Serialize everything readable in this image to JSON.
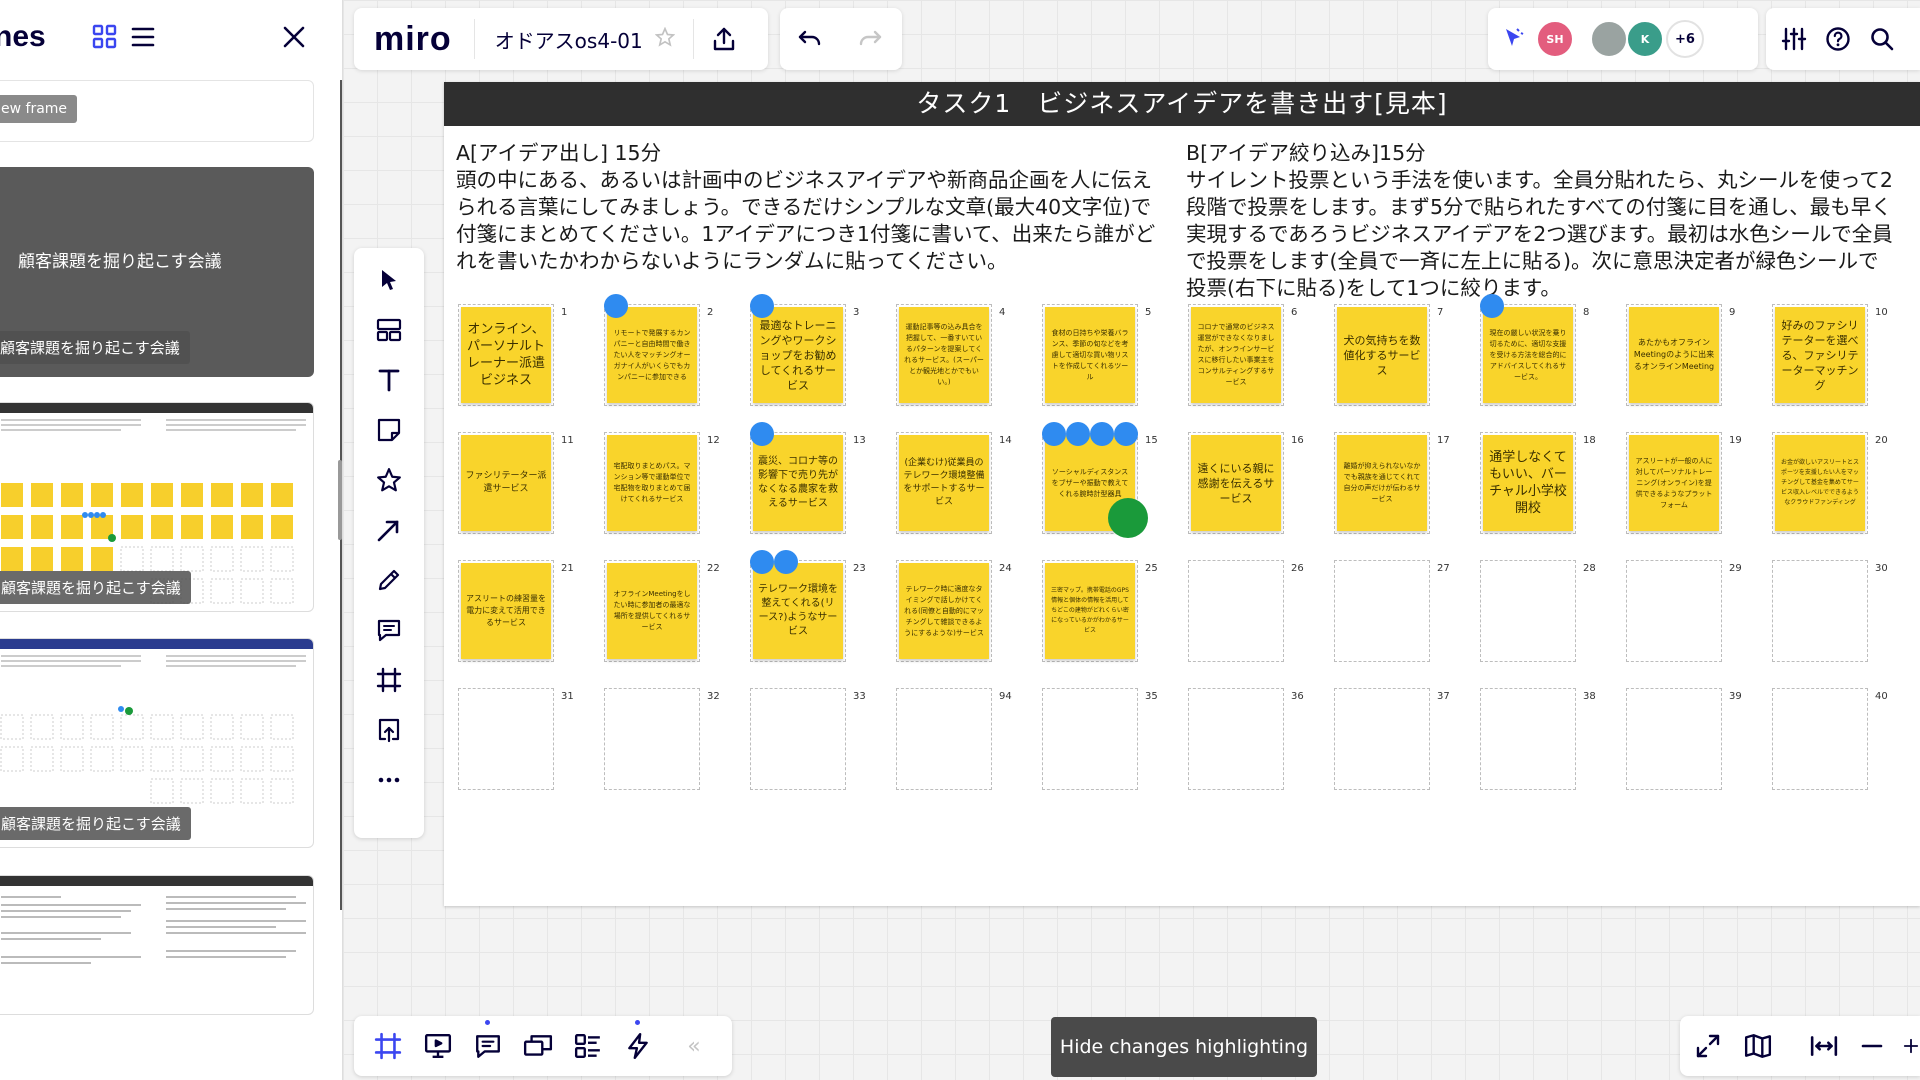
{
  "frames_panel": {
    "title": "nes",
    "new_frame_label": "ew frame",
    "thumb1_title": "顧客課題を掘り起こす会議",
    "thumb1_tag": "顧客課題を掘り起こす会議",
    "thumb2_tag": "顧客課題を掘り起こす会議",
    "thumb3_tag": "顧客課題を掘り起こす会議"
  },
  "topbar": {
    "logo": "miro",
    "board_name": "オドアスos4-01",
    "avatars": [
      {
        "initials": "SH",
        "color": "#e35d7e"
      },
      {
        "initials": "",
        "color": "#9aa3a1"
      },
      {
        "initials": "K",
        "color": "#3a9d8a"
      }
    ],
    "more_count": "+6"
  },
  "frame": {
    "title": "タスク1　ビジネスアイデアを書き出す[見本]",
    "text_a": "A[アイデア出し] 15分\n頭の中にある、あるいは計画中のビジネスアイデアや新商品企画を人に伝えられる言葉にしてみましょう。できるだけシンプルな文章(最大40文字位)で付箋にまとめてください。1アイデアにつき1付箋に書いて、出来たら誰がどれを書いたかわからないようにランダムに貼ってください。",
    "text_b": "B[アイデア絞り込み]15分\nサイレント投票という手法を使います。全員分貼れたら、丸シールを使って2段階で投票をします。まず5分で貼られたすべての付箋に目を通し、最も早く実現するであろうビジネスアイデアを2つ選びます。最初は水色シールで全員で投票をします(全員で一斉に左上に貼る)。次に意思決定者が緑色シールで投票(右下に貼る)をして1つに絞ります。"
  },
  "cells": [
    {
      "num": "1",
      "text": "オンライン、パーソナルトレーナー派遣ビジネス",
      "size": 13
    },
    {
      "num": "2",
      "text": "リモートで発展するカンパニーと自由時間で働きたい人をマッチングオーガナイ人がいくらでもカンパニーに参加できる",
      "size": 7
    },
    {
      "num": "3",
      "text": "最適なトレーニングやワークショップをお勧めしてくれるサービス",
      "size": 11
    },
    {
      "num": "4",
      "text": "運動記事等の込み具合を把握して、一番すいているパターンを提案してくれるサービス。(スーパーとか観光地とかでもいい。)",
      "size": 7
    },
    {
      "num": "5",
      "text": "食材の日持ちや栄養バランス、季節の旬などを考慮して適切な買い物リストを作成してくれるツール",
      "size": 7
    },
    {
      "num": "6",
      "text": "コロナで通常のビジネス運営ができなくなりましたが、オンラインサービスに移行したい事業主をコンサルティングするサービス",
      "size": 7
    },
    {
      "num": "7",
      "text": "犬の気持ちを数値化するサービス",
      "size": 11
    },
    {
      "num": "8",
      "text": "現在の厳しい状況を乗り切るために、適切な支援を受ける方法を総合的にアドバイスしてくれるサービス。",
      "size": 7
    },
    {
      "num": "9",
      "text": "あたかもオフラインMeetingのように出来るオンラインMeeting",
      "size": 8
    },
    {
      "num": "10",
      "text": "好みのファシリテーターを選べる、ファシリテーターマッチング",
      "size": 11
    },
    {
      "num": "11",
      "text": "ファシリテーター派遣サービス",
      "size": 9
    },
    {
      "num": "12",
      "text": "宅配取りまとめパス。マンション等で運動単位で宅配物を取りまとめて届けてくれるサービス",
      "size": 7
    },
    {
      "num": "13",
      "text": "震災、コロナ等の影響下で売り先がなくなる農家を救えるサービス",
      "size": 10
    },
    {
      "num": "14",
      "text": "(企業むけ)従業員のテレワーク環境整備をサポートするサービス",
      "size": 9
    },
    {
      "num": "15",
      "text": "ソーシャルディスタンスをブザーや振動で教えてくれる腕時計型器具",
      "size": 7
    },
    {
      "num": "16",
      "text": "遠くにいる親に感謝を伝えるサービス",
      "size": 11
    },
    {
      "num": "17",
      "text": "離婚が抑えられないなかでも親族を通じてくれて自分の声だけが伝わるサービス",
      "size": 7
    },
    {
      "num": "18",
      "text": "通学しなくてもいい、バーチャル小学校開校",
      "size": 13
    },
    {
      "num": "19",
      "text": "アスリートが一般の人に対してパーソナルトレーニング(オンライン)を提供できるようなプラットフォーム",
      "size": 7
    },
    {
      "num": "20",
      "text": "お金が欲しいアスリートとスポーツを支援したい人をマッチングして基金を集めてサービス収入レベルでできるようなクラウドファンディング",
      "size": 6
    },
    {
      "num": "21",
      "text": "アスリートの練習量を電力に変えて活用できるサービス",
      "size": 8
    },
    {
      "num": "22",
      "text": "オフラインMeetingをしたい時に参加者の最適な場所を提供してくれるサービス",
      "size": 7
    },
    {
      "num": "23",
      "text": "テレワーク環境を整えてくれる(リース?)ようなサービス",
      "size": 10
    },
    {
      "num": "24",
      "text": "テレワーク時に適度なタイミングで話しかけてくれる(同僚と自動的にマッチングして雑談できるようにするような)サービス",
      "size": 7
    },
    {
      "num": "25",
      "text": "三密マップ。携帯電話のGPS情報と個体の情報を活用してちどこの建物がどれくらい密になっているかがわかるサービス",
      "size": 6
    },
    {
      "num": "26"
    },
    {
      "num": "27"
    },
    {
      "num": "28"
    },
    {
      "num": "29"
    },
    {
      "num": "30"
    },
    {
      "num": "31"
    },
    {
      "num": "32"
    },
    {
      "num": "33"
    },
    {
      "num": "94"
    },
    {
      "num": "35"
    },
    {
      "num": "36"
    },
    {
      "num": "37"
    },
    {
      "num": "38"
    },
    {
      "num": "39"
    },
    {
      "num": "40"
    }
  ],
  "votes": {
    "blue_color": "#2f8bf0",
    "green_color": "#1a9a3a",
    "blue": [
      {
        "cell": 1,
        "count": 1
      },
      {
        "cell": 2,
        "count": 1
      },
      {
        "cell": 7,
        "count": 1
      },
      {
        "cell": 12,
        "count": 1
      },
      {
        "cell": 14,
        "count": 4
      },
      {
        "cell": 22,
        "count": 2
      }
    ],
    "green": [
      {
        "cell": 14
      }
    ]
  },
  "toolbar": {
    "tools": [
      "select-cursor-icon",
      "templates-icon",
      "text-icon",
      "sticky-note-icon",
      "shapes-star-icon",
      "connection-line-icon",
      "pen-icon",
      "comment-icon",
      "frame-icon",
      "upload-icon",
      "more-icon"
    ]
  },
  "bottom": {
    "hide_changes_label": "Hide changes highlighting",
    "collapse_label": "«"
  }
}
